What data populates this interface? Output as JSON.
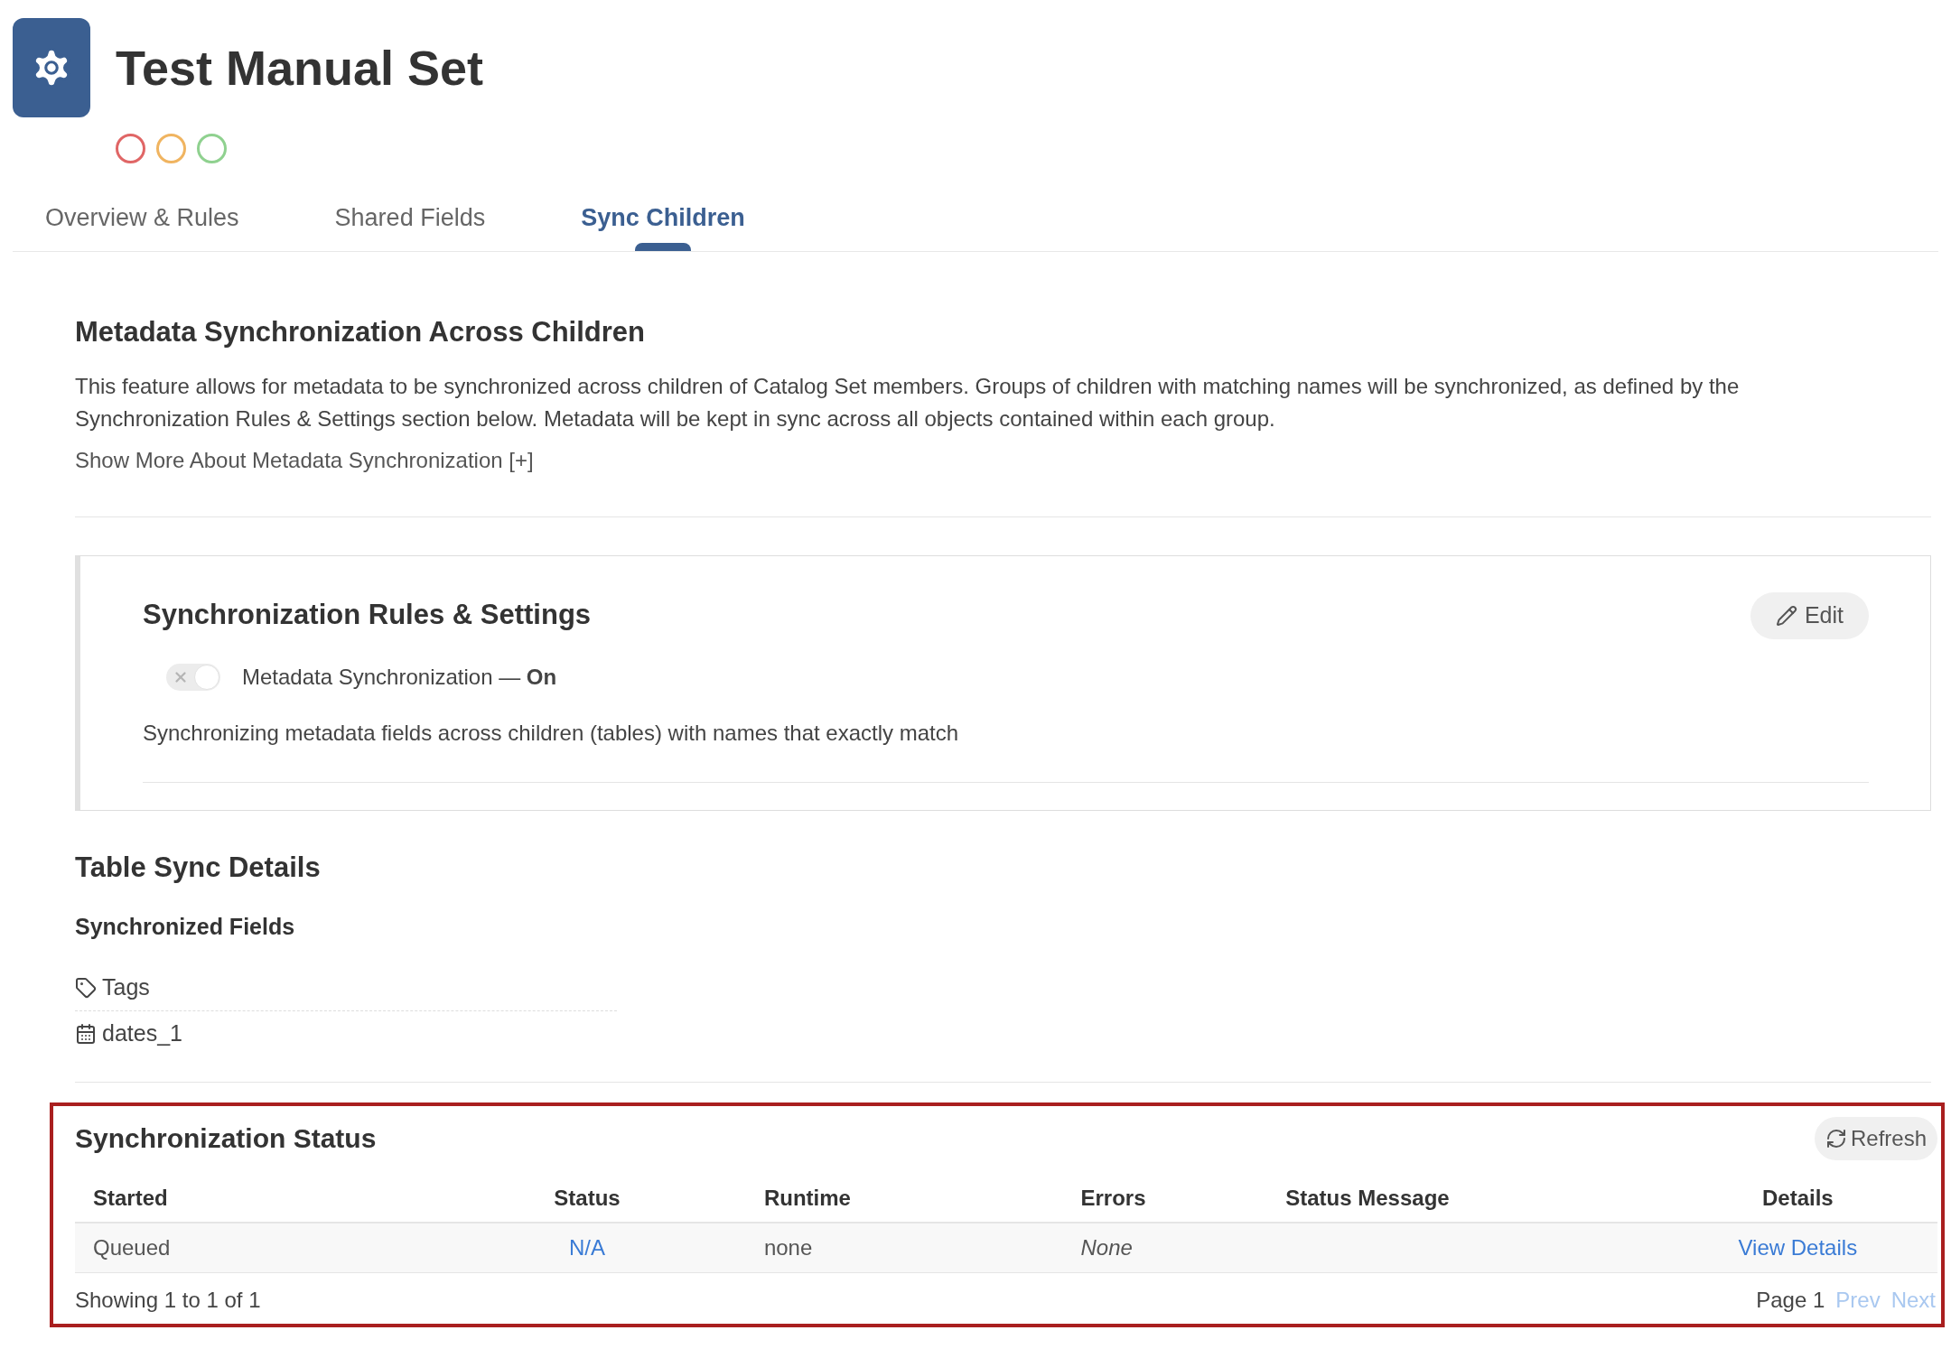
{
  "header": {
    "title": "Test Manual Set",
    "status_dots": [
      {
        "color": "#e06666"
      },
      {
        "color": "#f0b460"
      },
      {
        "color": "#8fd18f"
      }
    ]
  },
  "tabs": [
    {
      "label": "Overview & Rules",
      "selected": false
    },
    {
      "label": "Shared Fields",
      "selected": false
    },
    {
      "label": "Sync Children",
      "selected": true
    }
  ],
  "intro": {
    "heading": "Metadata Synchronization Across Children",
    "text": "This feature allows for metadata to be synchronized across children of Catalog Set members. Groups of children with matching names will be synchronized, as defined by the Synchronization Rules & Settings section below. Metadata will be kept in sync across all objects contained within each group.",
    "show_more": "Show More About Metadata Synchronization [+]"
  },
  "rules": {
    "heading": "Synchronization Rules & Settings",
    "edit_button": "Edit",
    "toggle": {
      "label": "Metadata Synchronization — **On**",
      "on": true
    },
    "description": "Synchronizing metadata fields across children (tables) with names that exactly match"
  },
  "table_sync": {
    "heading": "Table Sync Details",
    "subheading": "Synchronized Fields",
    "fields": [
      {
        "kind": "tag",
        "label": "Tags"
      },
      {
        "kind": "date",
        "label": "dates_1"
      }
    ]
  },
  "sync_status": {
    "heading": "Synchronization Status",
    "refresh_button": "Refresh",
    "columns": [
      "Started",
      "Status",
      "Runtime",
      "Errors",
      "Status Message",
      "Details"
    ],
    "rows": [
      {
        "started": "Queued",
        "status": "N/A",
        "runtime": "none",
        "errors": "None",
        "details": "View Details"
      }
    ],
    "footer": {
      "summary": "Showing 1 to 1 of 1",
      "page": "Page 1",
      "prev": {
        "label": "Prev",
        "disabled": true
      },
      "next": {
        "label": "Next",
        "disabled": true
      }
    }
  }
}
